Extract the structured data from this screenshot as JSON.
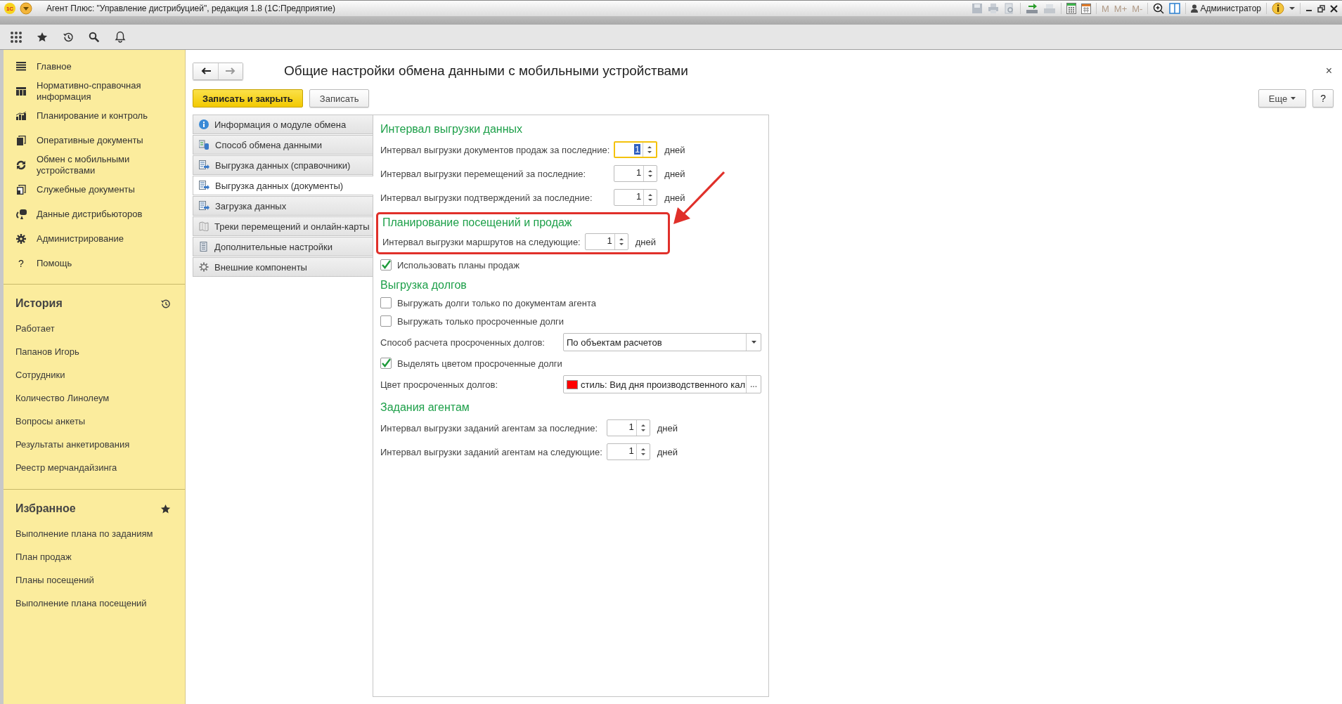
{
  "window": {
    "logo": "1С",
    "title": "Агент Плюс: \"Управление дистрибуцией\", редакция 1.8  (1С:Предприятие)",
    "memory_keys": [
      "M",
      "M+",
      "M-"
    ],
    "user": "Администратор"
  },
  "sidebar": {
    "nav": [
      {
        "label": "Главное",
        "kind": "menu"
      },
      {
        "label": "Нормативно-справочная информация",
        "kind": "catalog"
      },
      {
        "label": "Планирование и контроль",
        "kind": "chart"
      },
      {
        "label": "Оперативные документы",
        "kind": "docs"
      },
      {
        "label": "Обмен с мобильными устройствами",
        "kind": "sync"
      },
      {
        "label": "Служебные документы",
        "kind": "service"
      },
      {
        "label": "Данные дистрибьюторов",
        "kind": "distrib"
      },
      {
        "label": "Администрирование",
        "kind": "gear"
      },
      {
        "label": "Помощь",
        "kind": "help",
        "glyph": "?"
      }
    ],
    "history": {
      "title": "История",
      "items": [
        "Работает",
        "Папанов Игорь",
        "Сотрудники",
        "Количество Линолеум",
        "Вопросы анкеты",
        "Результаты анкетирования",
        "Реестр мерчандайзинга"
      ]
    },
    "favorites": {
      "title": "Избранное",
      "items": [
        "Выполнение плана по заданиям",
        "План продаж",
        "Планы посещений",
        "Выполнение плана посещений"
      ]
    }
  },
  "form": {
    "title": "Общие настройки обмена данными с мобильными устройствами",
    "close": "×",
    "save_close": "Записать и закрыть",
    "save": "Записать",
    "more": "Еще",
    "help": "?",
    "tabs": [
      {
        "label": "Информация о модуле обмена",
        "kind": "info",
        "selected": false
      },
      {
        "label": "Способ обмена данными",
        "kind": "exchange",
        "selected": false
      },
      {
        "label": "Выгрузка данных (справочники)",
        "kind": "upload",
        "selected": false
      },
      {
        "label": "Выгрузка данных (документы)",
        "kind": "upload",
        "selected": true
      },
      {
        "label": "Загрузка данных",
        "kind": "upload",
        "selected": false
      },
      {
        "label": "Треки перемещений и онлайн-карты",
        "kind": "map",
        "selected": false
      },
      {
        "label": "Дополнительные настройки",
        "kind": "list",
        "selected": false
      },
      {
        "label": "Внешние компоненты",
        "kind": "gear",
        "selected": false
      }
    ],
    "groups": [
      {
        "title": "Интервал выгрузки данных",
        "highlighted": false,
        "rows": [
          {
            "kind": "number",
            "label": "Интервал выгрузки документов продаж за последние:",
            "value": "1",
            "unit": "дней",
            "focused": true
          },
          {
            "kind": "number",
            "label": "Интервал выгрузки перемещений за последние:",
            "value": "1",
            "unit": "дней",
            "focused": false
          },
          {
            "kind": "number",
            "label": "Интервал выгрузки подтверждений за последние:",
            "value": "1",
            "unit": "дней",
            "focused": false
          }
        ]
      },
      {
        "title": "Планирование посещений и продаж",
        "highlighted": true,
        "rows": [
          {
            "kind": "number",
            "label": "Интервал выгрузки маршрутов на следующие:",
            "value": "1",
            "unit": "дней",
            "focused": false
          }
        ]
      },
      {
        "highlighted": false,
        "rows": [
          {
            "kind": "checkbox",
            "label": "Использовать планы продаж",
            "checked": true
          }
        ]
      },
      {
        "title": "Выгрузка долгов",
        "highlighted": false,
        "rows": [
          {
            "kind": "checkbox",
            "label": "Выгружать долги только по документам агента",
            "checked": false
          },
          {
            "kind": "checkbox",
            "label": "Выгружать только просроченные долги",
            "checked": false
          },
          {
            "kind": "select",
            "label": "Способ расчета просроченных долгов:",
            "value": "По объектам расчетов"
          },
          {
            "kind": "checkbox",
            "label": "Выделять цветом просроченные долги",
            "checked": true
          },
          {
            "kind": "color",
            "label": "Цвет просроченных долгов:",
            "value": "стиль: Вид дня производственного кал",
            "color": "#ff0000",
            "button": "..."
          }
        ]
      },
      {
        "title": "Задания агентам",
        "highlighted": false,
        "rows": [
          {
            "kind": "number",
            "label": "Интервал выгрузки заданий агентам за последние:",
            "value": "1",
            "unit": "дней",
            "focused": false
          },
          {
            "kind": "number",
            "label": "Интервал выгрузки заданий агентам на следующие:",
            "value": "1",
            "unit": "дней",
            "focused": false
          }
        ]
      }
    ]
  }
}
